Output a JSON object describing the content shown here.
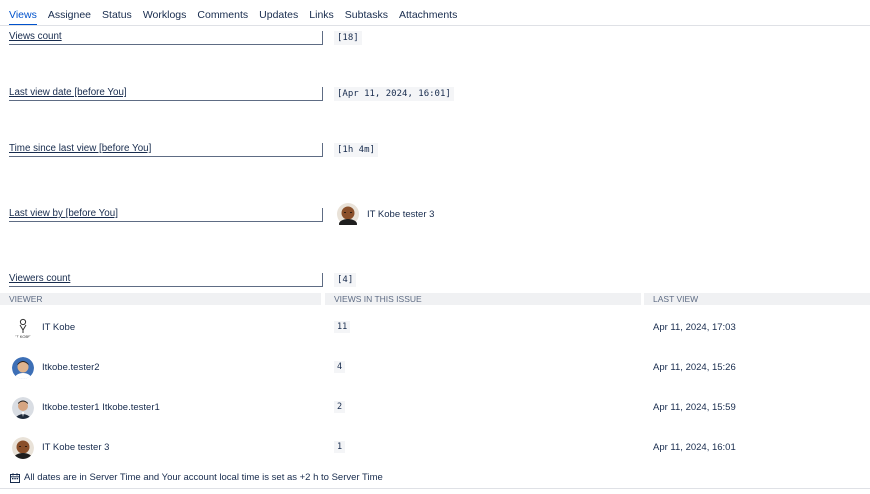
{
  "tabs": [
    "Views",
    "Assignee",
    "Status",
    "Worklogs",
    "Comments",
    "Updates",
    "Links",
    "Subtasks",
    "Attachments"
  ],
  "fields": {
    "views_count": {
      "label": "Views count",
      "value": "[18]"
    },
    "last_view_date": {
      "label": "Last view date [before You]",
      "value": "[Apr 11, 2024, 16:01]"
    },
    "time_since": {
      "label": "Time since last view [before You]",
      "value": "[1h 4m]"
    },
    "last_view_by": {
      "label": "Last view by [before You]",
      "value": "IT Kobe tester 3"
    },
    "viewers_count": {
      "label": "Viewers count",
      "value": "[4]"
    }
  },
  "table": {
    "headers": [
      "VIEWER",
      "VIEWS IN THIS ISSUE",
      "LAST VIEW"
    ],
    "rows": [
      {
        "viewer": "IT Kobe",
        "views": "11",
        "last": "Apr 11, 2024, 17:03",
        "avatar": "itkobe-logo"
      },
      {
        "viewer": "Itkobe.tester2",
        "views": "4",
        "last": "Apr 11, 2024, 15:26",
        "avatar": "person-blue"
      },
      {
        "viewer": "Itkobe.tester1 Itkobe.tester1",
        "views": "2",
        "last": "Apr 11, 2024, 15:59",
        "avatar": "person-suit"
      },
      {
        "viewer": "IT Kobe tester 3",
        "views": "1",
        "last": "Apr 11, 2024, 16:01",
        "avatar": "person-brown"
      }
    ]
  },
  "footer": {
    "note": "All dates are in Server Time and Your account local time is set as +2 h to Server Time",
    "icon": "calendar-icon"
  },
  "colors": {
    "accent": "#0052cc",
    "text": "#172b4d",
    "muted": "#5e6c84",
    "header_bg": "#f0f1f3"
  }
}
